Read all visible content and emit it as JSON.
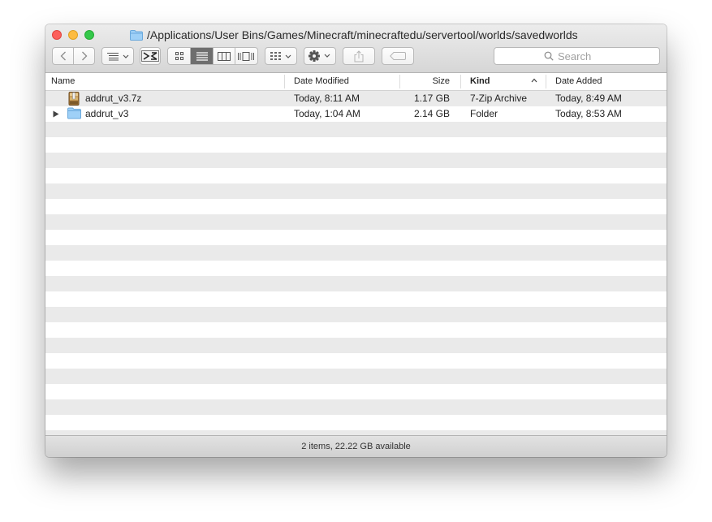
{
  "window": {
    "title": "/Applications/User Bins/Games/Minecraft/minecraftedu/servertool/worlds/savedworlds"
  },
  "toolbar": {
    "search": {
      "placeholder": "Search"
    }
  },
  "columns": {
    "name": "Name",
    "date_modified": "Date Modified",
    "size": "Size",
    "kind": "Kind",
    "date_added": "Date Added",
    "sorted_by": "kind"
  },
  "files": [
    {
      "name": "addrut_v3.7z",
      "date_modified": "Today, 8:11 AM",
      "size": "1.17 GB",
      "kind": "7-Zip Archive",
      "date_added": "Today, 8:49 AM",
      "icon": "archive-icon"
    },
    {
      "name": "addrut_v3",
      "date_modified": "Today, 1:04 AM",
      "size": "2.14 GB",
      "kind": "Folder",
      "date_added": "Today, 8:53 AM",
      "icon": "folder-icon"
    }
  ],
  "status": {
    "text": "2 items, 22.22 GB available"
  },
  "colors": {
    "close": "#fc605c",
    "minimize": "#fdbc40",
    "zoom": "#34c84a",
    "folder": "#9ed0f7",
    "stripe": "#eaeaea"
  }
}
